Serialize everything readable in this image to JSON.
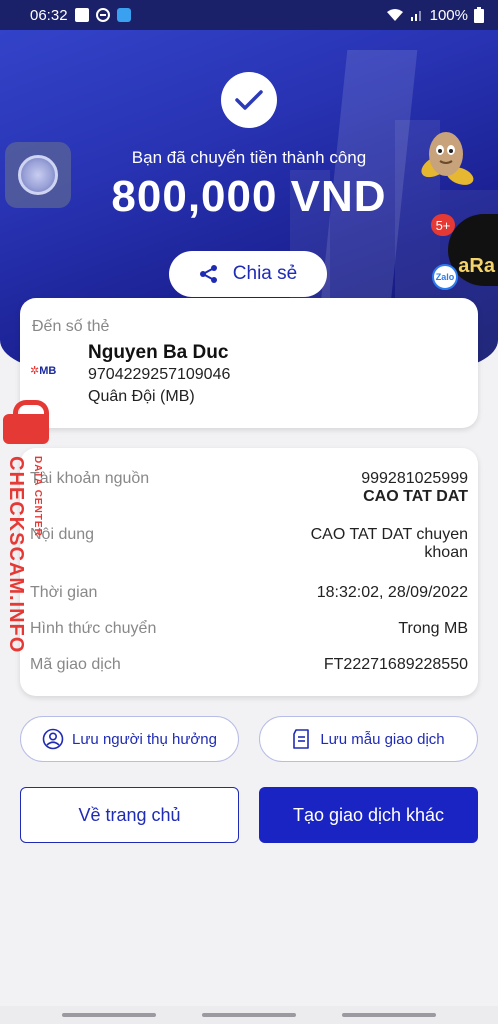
{
  "status_bar": {
    "time": "06:32",
    "battery": "100%"
  },
  "hero": {
    "success_message": "Bạn đã chuyển tiền thành công",
    "amount": "800,000 VND",
    "share_label": "Chia sẻ"
  },
  "chat_bubble": {
    "badge_count": "5+",
    "avatar_text": "aRa",
    "app_badge": "Zalo"
  },
  "recipient": {
    "label": "Đến số thẻ",
    "bank_logo": "MB",
    "name": "Nguyen Ba Duc",
    "account_number": "9704229257109046",
    "bank_name": "Quân Đội (MB)"
  },
  "details": {
    "source_label": "Tài khoản nguồn",
    "source_account": "999281025999",
    "source_name": "CAO TAT DAT",
    "content_label": "Nội dung",
    "content_line1": "CAO TAT DAT chuyen",
    "content_line2": "khoan",
    "time_label": "Thời gian",
    "time_value": "18:32:02, 28/09/2022",
    "method_label": "Hình thức chuyển",
    "method_value": "Trong MB",
    "tx_id_label": "Mã giao dịch",
    "tx_id_value": "FT22271689228550"
  },
  "watermark": {
    "main": "CHECKSCAM.INFO",
    "sub": "DATA CENTER"
  },
  "actions": {
    "save_recipient": "Lưu người thụ hưởng",
    "save_template": "Lưu mẫu giao dịch",
    "home": "Về trang chủ",
    "new_transaction": "Tạo giao dịch khác"
  },
  "colors": {
    "primary": "#1a24c2",
    "hero_dark": "#141a6e",
    "hero_light": "#3343c9",
    "watermark": "#e53935"
  }
}
